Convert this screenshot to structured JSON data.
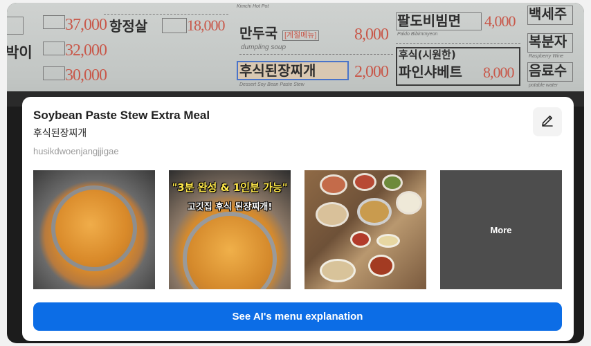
{
  "menu_board": {
    "items": [
      {
        "kor": "만두국",
        "tag": "[계절메뉴]",
        "eng": "dumpling soup",
        "price": "8,000"
      },
      {
        "kor": "후식된장찌개",
        "eng": "Dessert Soy Bean Paste Stew",
        "price": "2,000"
      },
      {
        "kor": "팔도비빔면",
        "eng": "Paldo Bibimmyeon",
        "price": "4,000"
      },
      {
        "kor": "후식(시원한)",
        "eng": "",
        "price": ""
      },
      {
        "kor": "파인샤베트",
        "eng": "",
        "price": "8,000"
      },
      {
        "kor": "백세주",
        "eng": "",
        "price": ""
      },
      {
        "kor": "복분자",
        "eng": "Raspberry Wine",
        "price": ""
      },
      {
        "kor": "음료수",
        "eng": "potable water",
        "price": ""
      },
      {
        "kor": "항정살",
        "eng": "",
        "price": "18,000"
      },
      {
        "kor": "박이",
        "eng": "",
        "price": ""
      }
    ],
    "left_prices": [
      "37,000",
      "32,000",
      "30,000"
    ],
    "partial_top": [
      "Kimchi Hot Pot"
    ]
  },
  "card": {
    "title": "Soybean Paste Stew Extra Meal",
    "korean_name": "후식된장찌개",
    "romanization": "husikdwoenjangjjigae",
    "edit_icon": "pencil-icon",
    "thumbnails": [
      {
        "overlay_line1": "",
        "overlay_line2": ""
      },
      {
        "overlay_line1": "\"3분 완성 & 1인분 가능\"",
        "overlay_line2": "고깃집 후식 된장찌개!"
      },
      {
        "overlay_line1": "",
        "overlay_line2": ""
      }
    ],
    "more_label": "More",
    "cta_label": "See AI's menu explanation",
    "cta_color": "#0c6de6"
  }
}
